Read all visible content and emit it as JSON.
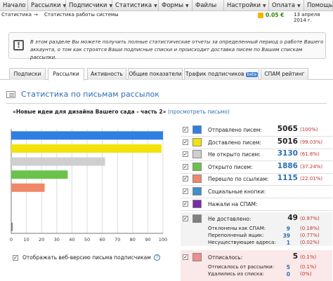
{
  "nav": {
    "items": [
      {
        "label": "Начало",
        "caret": false
      },
      {
        "label": "Рассылки",
        "caret": true
      },
      {
        "label": "Подписчики",
        "caret": true
      },
      {
        "label": "Статистика",
        "caret": true
      },
      {
        "label": "Формы",
        "caret": true
      },
      {
        "label": "Файлы",
        "caret": false
      },
      {
        "label": "Настройки",
        "caret": true
      },
      {
        "label": "Оплата",
        "caret": true
      },
      {
        "label": "Помощь",
        "caret": false
      }
    ]
  },
  "breadcrumb": {
    "root": "Статистика",
    "arrow": "→",
    "current": "Статистика работы системы"
  },
  "balance": "0.05 €",
  "date": "13 апреля 2014 г.",
  "info": {
    "icon": "!",
    "text": "В этом разделе Вы можете получить полные статистические отчеты за определенный период о работе Вашего аккаунта, о том как строятся Ваши подписные списки и происходит доставка писем по Вашим спискам рассылки."
  },
  "tabs": [
    {
      "label": "Подписки",
      "active": false
    },
    {
      "label": "Рассылки",
      "active": true
    },
    {
      "label": "Активность",
      "active": false
    },
    {
      "label": "Общие показатели",
      "active": false
    },
    {
      "label": "Трафик подписчиков",
      "active": false,
      "badge": "beta"
    },
    {
      "label": "СПАМ рейтинг",
      "active": false
    }
  ],
  "section_title": "Статистика по письмам рассылок",
  "campaign": {
    "name": "«Новые идеи для дизайна Вашего сада - часть 2»",
    "preview_link": "(просмотреть письмо)"
  },
  "web_version": {
    "checked": true,
    "label": "Отображать веб-версию письма подписчикам",
    "help": "?"
  },
  "chart_data": {
    "type": "bar",
    "orientation": "horizontal",
    "x_ticks": [
      "0",
      "10",
      "20",
      "30",
      "40",
      "50",
      "60",
      "70",
      "80",
      "90",
      "100"
    ],
    "xlim": [
      0,
      100
    ],
    "categories": [
      "Отправлено писем:",
      "Доставлено писем:",
      "Не открыто писем:",
      "Открыто писем:",
      "Перешло по ссылкам:",
      "Социальные кнопки:",
      "Нажали на СПАМ:",
      "Не доставлено:"
    ],
    "values": [
      100,
      99.03,
      61.8,
      37.24,
      22.01,
      0,
      0,
      0.97
    ],
    "colors": [
      "#2f7fe3",
      "#f2e30a",
      "#cfcfcf",
      "#6bc24a",
      "#f08868",
      "#3e8ed0",
      "#7a2ca8",
      "#808080"
    ]
  },
  "stats": [
    {
      "label": "Отправлено писем:",
      "value": "5065",
      "pct": "(100%)",
      "color": "#2f7fe3",
      "checked": true,
      "blue": false
    },
    {
      "label": "Доставлено писем:",
      "value": "5016",
      "pct": "(99.03%)",
      "color": "#f2e30a",
      "checked": true,
      "blue": false
    },
    {
      "label": "Не открыто писем:",
      "value": "3130",
      "pct": "(61.8%)",
      "color": "#cfcfcf",
      "checked": true,
      "blue": true
    },
    {
      "label": "Открыто писем:",
      "value": "1886",
      "pct": "(37.24%)",
      "color": "#6bc24a",
      "checked": true,
      "blue": true
    },
    {
      "label": "Перешло по ссылкам:",
      "value": "1115",
      "pct": "(22.01%)",
      "color": "#f08868",
      "checked": true,
      "blue": true
    },
    {
      "label": "Социальные кнопки:",
      "value": "",
      "pct": "",
      "color": "#3e8ed0",
      "checked": true,
      "blue": false
    },
    {
      "label": "Нажали на СПАМ:",
      "value": "",
      "pct": "",
      "color": "#7a2ca8",
      "checked": true,
      "blue": false
    }
  ],
  "undelivered": {
    "label": "Не доставлено:",
    "value": "49",
    "pct": "(0.97%)",
    "color": "#808080",
    "checked": true,
    "sub": [
      {
        "label": "Отклонены как СПАМ:",
        "value": "9",
        "pct": "(0.18%)"
      },
      {
        "label": "Переполненый ящик:",
        "value": "39",
        "pct": "(0.77%)"
      },
      {
        "label": "Несуществующие адреса:",
        "value": "1",
        "pct": "(0.02%)"
      }
    ]
  },
  "unsubscribed": {
    "label": "Отписалось:",
    "value": "5",
    "pct": "(0.1%)",
    "color": "#f08c8c",
    "checked": true,
    "sub": [
      {
        "label": "Отписалось от рассылки:",
        "value": "5",
        "pct": "(0.1%)"
      },
      {
        "label": "Удалились из списка:",
        "value": "0",
        "pct": "(0%)"
      }
    ]
  }
}
